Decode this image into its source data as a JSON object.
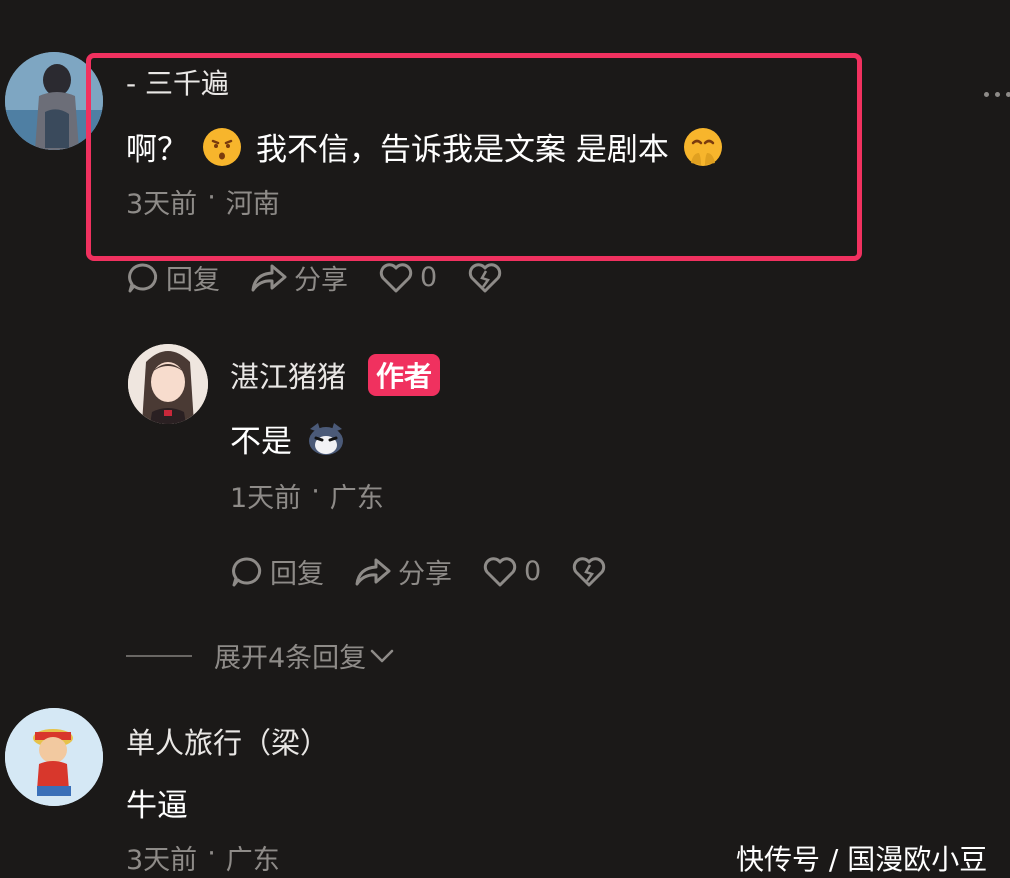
{
  "comments": {
    "first": {
      "username": "- 三千遍",
      "text_a": "啊？",
      "text_b": "我不信，告诉我是文案 是剧本",
      "time": "3天前",
      "location": "河南",
      "reply_label": "回复",
      "share_label": "分享",
      "like_count": "0"
    },
    "reply": {
      "username": "湛江猪猪",
      "badge": "作者",
      "text": "不是",
      "time": "1天前",
      "location": "广东",
      "reply_label": "回复",
      "share_label": "分享",
      "like_count": "0"
    },
    "expand_label": "展开4条回复",
    "third": {
      "username": "单人旅行（梁）",
      "text": "牛逼",
      "time": "3天前",
      "location": "广东"
    }
  },
  "meta_separator": "·",
  "watermark": "快传号 / 国漫欧小豆",
  "colors": {
    "background": "#1b1918",
    "highlight": "#f0315f",
    "muted_text": "#8e8b88",
    "badge": "#f0315f"
  },
  "icons": [
    "comment-icon",
    "share-icon",
    "heart-icon",
    "broken-heart-icon",
    "chevron-down-icon",
    "more-icon"
  ]
}
